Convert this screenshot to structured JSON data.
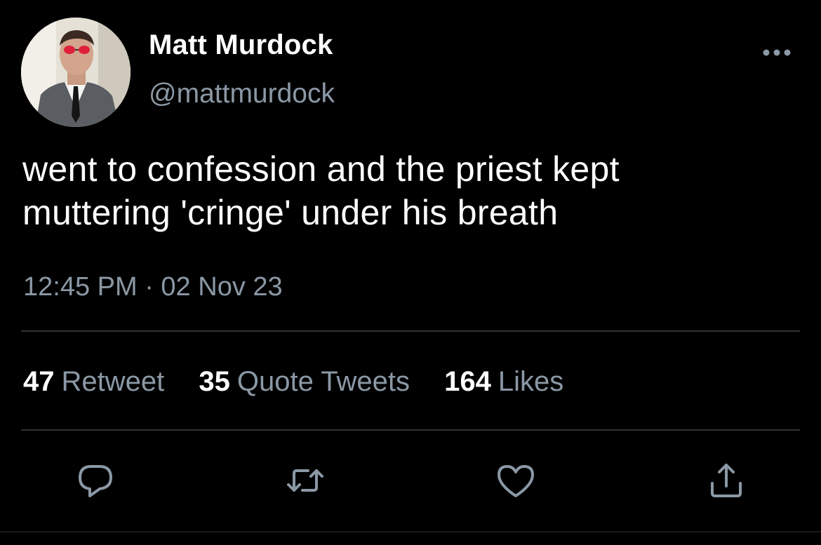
{
  "author": {
    "display_name": "Matt Murdock",
    "handle": "@mattmurdock",
    "avatar_icon": "profile-photo"
  },
  "tweet": {
    "text_line1": "went to confession and the priest kept",
    "text_line2": "muttering 'cringe' under his breath",
    "timestamp": "12:45 PM · 02 Nov 23"
  },
  "stats": {
    "retweets_count": "47",
    "retweets_label": "Retweet",
    "quotes_count": "35",
    "quotes_label": "Quote Tweets",
    "likes_count": "164",
    "likes_label": "Likes"
  },
  "actions": {
    "reply_icon": "reply-icon",
    "retweet_icon": "retweet-icon",
    "like_icon": "heart-icon",
    "share_icon": "share-icon",
    "more_icon": "more-icon"
  },
  "colors": {
    "background": "#000000",
    "primary_text": "#ffffff",
    "secondary_text": "#8b98a5",
    "divider": "#2f3336"
  }
}
